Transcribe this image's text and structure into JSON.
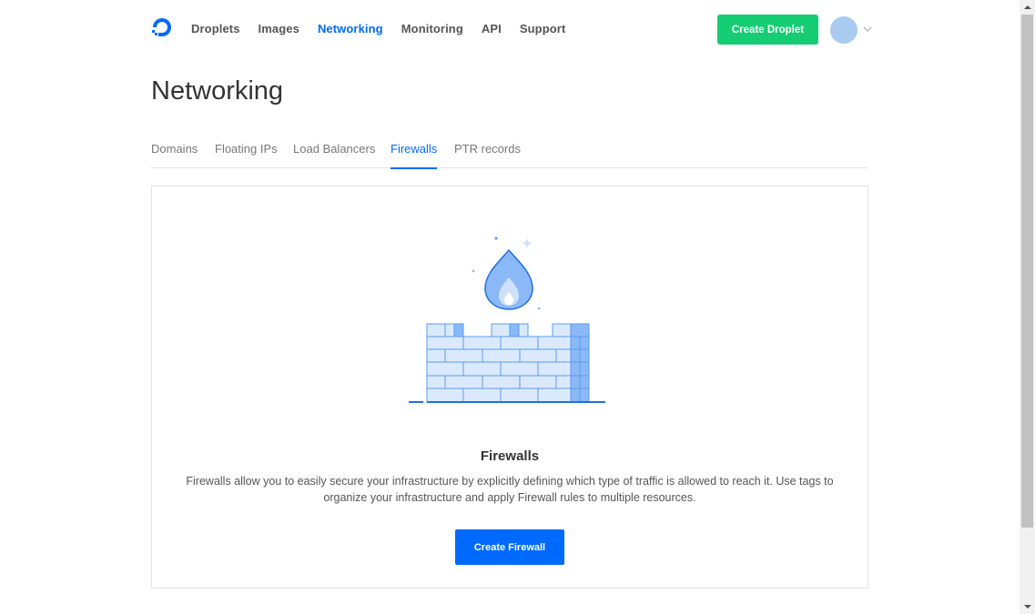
{
  "nav": {
    "logo_icon": "digitalocean-logo-icon",
    "links": [
      "Droplets",
      "Images",
      "Networking",
      "Monitoring",
      "API",
      "Support"
    ],
    "active": "Networking",
    "create_button": "Create Droplet",
    "avatar_icon": "avatar",
    "caret_icon": "chevron-down-icon"
  },
  "page": {
    "title": "Networking"
  },
  "tabs": {
    "items": [
      "Domains",
      "Floating IPs",
      "Load Balancers",
      "Firewalls",
      "PTR records"
    ],
    "active": "Firewalls"
  },
  "empty_state": {
    "illustration": "firewall-illustration",
    "title": "Firewalls",
    "description": "Firewalls allow you to easily secure your infrastructure by explicitly defining which type of traffic is allowed to reach it. Use tags to organize your infrastructure and apply Firewall rules to multiple resources.",
    "button": "Create Firewall"
  },
  "colors": {
    "accent": "#0069ff",
    "create_droplet": "#15cd72",
    "avatar": "#a9cbf0",
    "brick_fill": "#dbe9fc",
    "brick_stroke": "#5b9cf0",
    "flame": "#8bb9f7"
  }
}
